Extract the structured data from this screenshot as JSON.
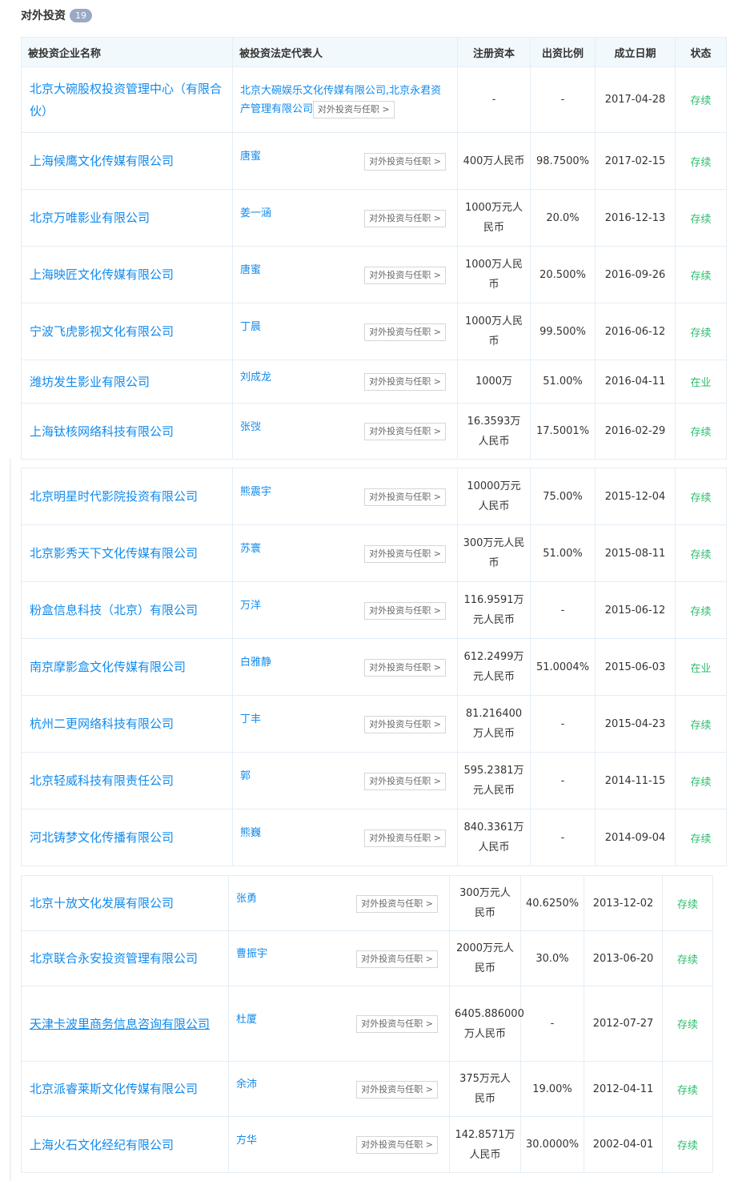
{
  "section": {
    "title": "对外投资",
    "count": "19"
  },
  "columns": {
    "company": "被投资企业名称",
    "representative": "被投资法定代表人",
    "capital": "注册资本",
    "ratio": "出资比例",
    "date": "成立日期",
    "status": "状态"
  },
  "invest_button_label": "对外投资与任职 >",
  "colors": {
    "link": "#128bed",
    "status": "#2dbd6e",
    "header_bg": "#f2f9fc",
    "badge": "#9aa9c4"
  },
  "rows": [
    {
      "company": "北京大碗股权投资管理中心（有限合伙）",
      "rep": "北京大碗娱乐文化传媒有限公司,北京永君资产管理有限公司",
      "capital": "-",
      "ratio": "-",
      "date": "2017-04-28",
      "status": "存续"
    },
    {
      "company": "上海候鹰文化传媒有限公司",
      "rep": "唐蜜",
      "capital": "400万人民币",
      "ratio": "98.7500%",
      "date": "2017-02-15",
      "status": "存续"
    },
    {
      "company": "北京万唯影业有限公司",
      "rep": "姜一涵",
      "capital": "1000万元人民币",
      "ratio": "20.0%",
      "date": "2016-12-13",
      "status": "存续"
    },
    {
      "company": "上海映匠文化传媒有限公司",
      "rep": "唐蜜",
      "capital": "1000万人民币",
      "ratio": "20.500%",
      "date": "2016-09-26",
      "status": "存续"
    },
    {
      "company": "宁波飞虎影视文化有限公司",
      "rep": "丁晨",
      "capital": "1000万人民币",
      "ratio": "99.500%",
      "date": "2016-06-12",
      "status": "存续"
    },
    {
      "company": "潍坊发生影业有限公司",
      "rep": "刘成龙",
      "capital": "1000万",
      "ratio": "51.00%",
      "date": "2016-04-11",
      "status": "在业"
    },
    {
      "company": "上海钛核网络科技有限公司",
      "rep": "张弢",
      "capital": "16.3593万人民币",
      "ratio": "17.5001%",
      "date": "2016-02-29",
      "status": "存续"
    },
    {
      "company": "北京明星时代影院投资有限公司",
      "rep": "熊震宇",
      "capital": "10000万元人民币",
      "ratio": "75.00%",
      "date": "2015-12-04",
      "status": "存续"
    },
    {
      "company": "北京影秀天下文化传媒有限公司",
      "rep": "苏寰",
      "capital": "300万元人民币",
      "ratio": "51.00%",
      "date": "2015-08-11",
      "status": "存续"
    },
    {
      "company": "粉盒信息科技（北京）有限公司",
      "rep": "万洋",
      "capital": "116.9591万元人民币",
      "ratio": "-",
      "date": "2015-06-12",
      "status": "存续"
    },
    {
      "company": "南京摩影盒文化传媒有限公司",
      "rep": "白雅静",
      "capital": "612.2499万元人民币",
      "ratio": "51.0004%",
      "date": "2015-06-03",
      "status": "在业"
    },
    {
      "company": "杭州二更网络科技有限公司",
      "rep": "丁丰",
      "capital": "81.216400万人民币",
      "ratio": "-",
      "date": "2015-04-23",
      "status": "存续"
    },
    {
      "company": "北京轻威科技有限责任公司",
      "rep": "郭",
      "capital": "595.2381万元人民币",
      "ratio": "-",
      "date": "2014-11-15",
      "status": "存续"
    },
    {
      "company": "河北铸梦文化传播有限公司",
      "rep": "熊巍",
      "capital": "840.3361万人民币",
      "ratio": "-",
      "date": "2014-09-04",
      "status": "存续"
    },
    {
      "company": "北京十放文化发展有限公司",
      "rep": "张勇",
      "capital": "300万元人民币",
      "ratio": "40.6250%",
      "date": "2013-12-02",
      "status": "存续"
    },
    {
      "company": "北京联合永安投资管理有限公司",
      "rep": "曹振宇",
      "capital": "2000万元人民币",
      "ratio": "30.0%",
      "date": "2013-06-20",
      "status": "存续"
    },
    {
      "company": "天津卡波里商务信息咨询有限公司",
      "rep": "杜厦",
      "capital": "6405.886000万人民币",
      "ratio": "-",
      "date": "2012-07-27",
      "status": "存续"
    },
    {
      "company": "北京派睿莱斯文化传媒有限公司",
      "rep": "余沛",
      "capital": "375万元人民币",
      "ratio": "19.00%",
      "date": "2012-04-11",
      "status": "存续"
    },
    {
      "company": "上海火石文化经纪有限公司",
      "rep": "方华",
      "capital": "142.8571万人民币",
      "ratio": "30.0000%",
      "date": "2002-04-01",
      "status": "存续"
    }
  ]
}
